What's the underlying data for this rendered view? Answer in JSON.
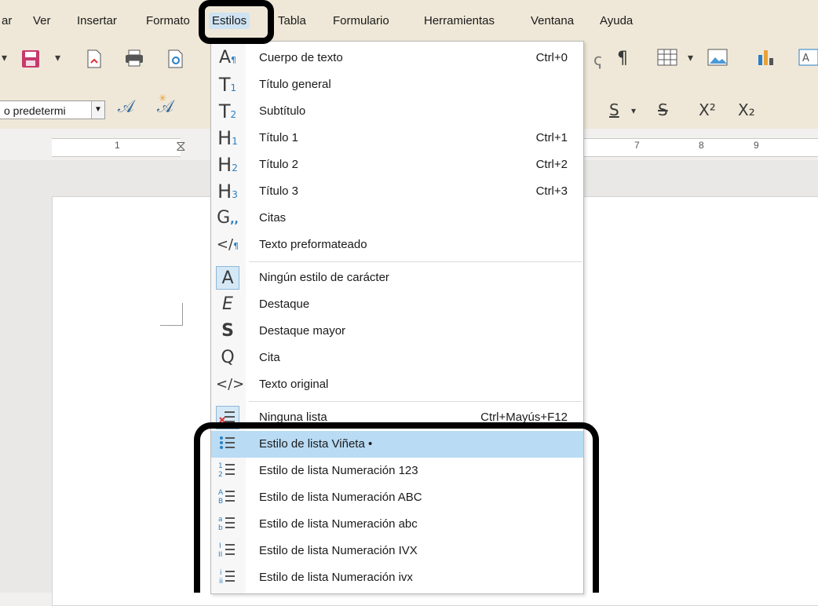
{
  "menubar": {
    "items": [
      "ar",
      "Ver",
      "Insertar",
      "Formato",
      "Estilos",
      "Tabla",
      "Formulario",
      "Herramientas",
      "Ventana",
      "Ayuda"
    ],
    "active": "Estilos"
  },
  "toolbar": {
    "style_combo_value": "o predetermi",
    "format_buttons": [
      "S",
      "S",
      "X²",
      "X₂"
    ],
    "ruler_numbers": [
      "1",
      "7",
      "8",
      "9"
    ]
  },
  "menu": {
    "items": [
      {
        "icon": "paragraph-text-body-icon",
        "label": "Cuerpo de texto",
        "shortcut": "Ctrl+0"
      },
      {
        "icon": "title-t1-icon",
        "label": "Título general",
        "shortcut": ""
      },
      {
        "icon": "subtitle-t2-icon",
        "label": "Subtítulo",
        "shortcut": ""
      },
      {
        "icon": "heading-1-icon",
        "label": "Título 1",
        "shortcut": "Ctrl+1"
      },
      {
        "icon": "heading-2-icon",
        "label": "Título 2",
        "shortcut": "Ctrl+2"
      },
      {
        "icon": "heading-3-icon",
        "label": "Título 3",
        "shortcut": "Ctrl+3"
      },
      {
        "icon": "quotations-icon",
        "label": "Citas",
        "shortcut": ""
      },
      {
        "icon": "preformatted-text-icon",
        "label": "Texto preformateado",
        "shortcut": ""
      },
      {
        "icon": "no-character-style-icon",
        "label": "Ningún estilo de carácter",
        "shortcut": ""
      },
      {
        "icon": "emphasis-icon",
        "label": "Destaque",
        "shortcut": ""
      },
      {
        "icon": "strong-emphasis-icon",
        "label": "Destaque mayor",
        "shortcut": ""
      },
      {
        "icon": "quote-icon",
        "label": "Cita",
        "shortcut": ""
      },
      {
        "icon": "source-text-icon",
        "label": "Texto original",
        "shortcut": ""
      },
      {
        "icon": "no-list-icon",
        "label": "Ninguna lista",
        "shortcut": "Ctrl+Mayús+F12"
      },
      {
        "icon": "bullet-list-icon",
        "label": "Estilo de lista Viñeta •",
        "shortcut": ""
      },
      {
        "icon": "numbered-list-123-icon",
        "label": "Estilo de lista Numeración 123",
        "shortcut": ""
      },
      {
        "icon": "numbered-list-abc-upper-icon",
        "label": "Estilo de lista Numeración ABC",
        "shortcut": ""
      },
      {
        "icon": "numbered-list-abc-lower-icon",
        "label": "Estilo de lista Numeración abc",
        "shortcut": ""
      },
      {
        "icon": "numbered-list-ivx-upper-icon",
        "label": "Estilo de lista Numeración IVX",
        "shortcut": ""
      },
      {
        "icon": "numbered-list-ivx-lower-icon",
        "label": "Estilo de lista Numeración ivx",
        "shortcut": ""
      }
    ],
    "highlighted": "Estilo de lista Viñeta •"
  },
  "colors": {
    "menu_highlight": "#b9dbf4",
    "toolbar_bg": "#efe8d8",
    "annotation": "#000000"
  }
}
